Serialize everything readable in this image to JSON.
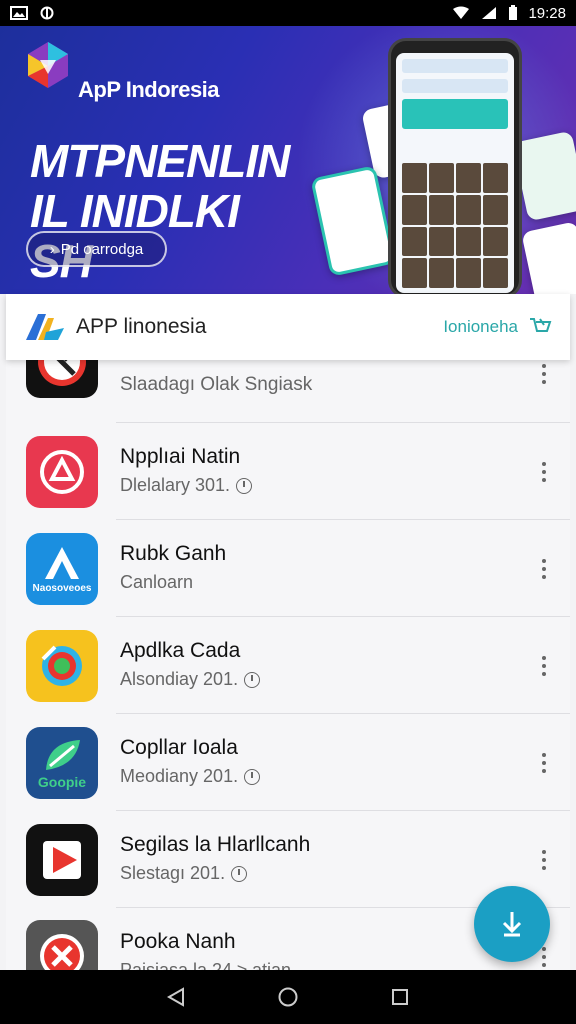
{
  "status_bar": {
    "time": "19:28",
    "icons": [
      "image-icon",
      "sync-icon",
      "wifi-icon",
      "signal-icon",
      "battery-icon"
    ]
  },
  "banner": {
    "brand": "ApP Indoresia",
    "headline": "MTPNENLIN IL INIDLKI SH",
    "cta_label": "Pd oarrodga"
  },
  "header": {
    "title": "APP linonesia",
    "right_label": "Ionionehа",
    "accent_color": "#2aa7a8"
  },
  "apps": [
    {
      "name": "",
      "subtitle": "Slaadagı Olak Sngiask",
      "icon": "cross-arrow-icon",
      "show_clock": false
    },
    {
      "name": "Npplıai Natin",
      "subtitle": "Dlelalary 301.",
      "icon": "triangle-ring-icon",
      "show_clock": true
    },
    {
      "name": "Rubk Ganh",
      "subtitle": "Canloarn",
      "icon": "letter-a-icon",
      "icon_caption": "Naosoveoes",
      "show_clock": false
    },
    {
      "name": "Apdlka Cada",
      "subtitle": "Alsondiay 201.",
      "icon": "camera-lens-icon",
      "show_clock": true
    },
    {
      "name": "Copllar Ioala",
      "subtitle": "Meodiany 201.",
      "icon": "leaf-icon",
      "icon_caption": "Goopie",
      "show_clock": true
    },
    {
      "name": "Segilas la Hlarllcanh",
      "subtitle": "Slestagı 201.",
      "icon": "play-arrow-icon",
      "show_clock": true
    },
    {
      "name": "Pooka Nanh",
      "subtitle": "Paisiasa la 24 ≥ atian",
      "icon": "x-circle-icon",
      "show_clock": false
    }
  ],
  "fab": {
    "icon": "download-icon",
    "color": "#1b9fc4"
  },
  "nav": {
    "icons": [
      "back-icon",
      "home-icon",
      "recents-icon"
    ]
  }
}
